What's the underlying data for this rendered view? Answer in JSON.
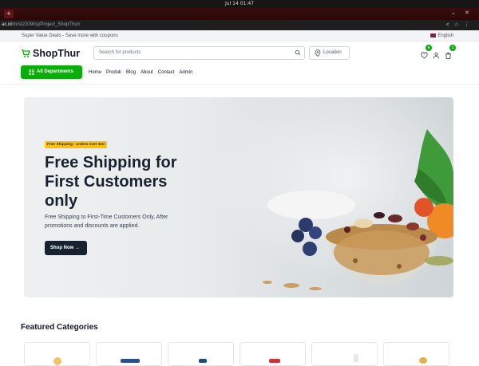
{
  "os": {
    "clock": "Jul 14 01:47"
  },
  "browser": {
    "url_host": "ac.id",
    "url_path": "/m/st22090sj/Project_ShopThur/"
  },
  "promo": {
    "text": "Super Value Deals - Save more with coupons",
    "language": "English"
  },
  "header": {
    "brand": "ShopThur",
    "search_placeholder": "Search for products",
    "location_label": "Location",
    "wishlist_count": "5",
    "cart_count": "1",
    "departments_label": "All Departments",
    "nav": [
      "Home",
      "Produk",
      "Blog",
      "About",
      "Contact",
      "Admin"
    ]
  },
  "hero": {
    "tag": "Free Shipping - orders over $10",
    "title": "Free Shipping for First Customers only",
    "subtitle": "Free Shipping to First-Time Customers Only, After promotions and discounts are applied.",
    "button": "Shop Now"
  },
  "featured": {
    "title": "Featured Categories"
  },
  "colors": {
    "brand_green": "#0aad0a",
    "dark": "#16232f",
    "tag_yellow": "#ffc107"
  }
}
